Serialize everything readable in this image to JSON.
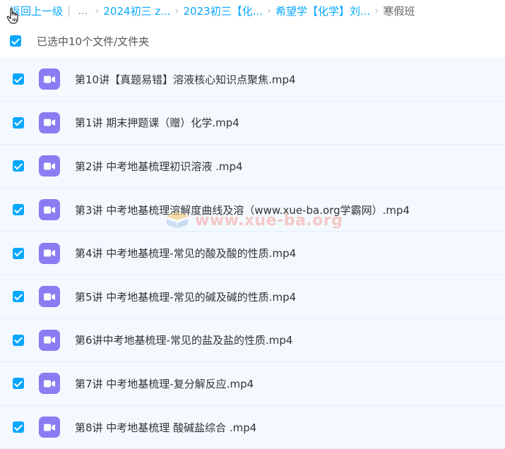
{
  "breadcrumb": {
    "back": "返回上一级",
    "divider": "|",
    "ellipsis": "...",
    "crumbs": [
      "2024初三 z...",
      "2023初三【化...",
      "希望学【化学】刘..."
    ],
    "current": "寒假班"
  },
  "selection": {
    "text": "已选中10个文件/文件夹"
  },
  "files": [
    {
      "name": "第10讲【真题易错】溶液核心知识点聚焦.mp4",
      "checked": true
    },
    {
      "name": "第1讲 期末押题课（赠）化学.mp4",
      "checked": true
    },
    {
      "name": "第2讲 中考地基梳理初识溶液 .mp4",
      "checked": true
    },
    {
      "name": "第3讲 中考地基梳理溶解度曲线及溶（www.xue-ba.org学霸网）.mp4",
      "checked": true
    },
    {
      "name": "第4讲 中考地基梳理-常见的酸及酸的性质.mp4",
      "checked": true
    },
    {
      "name": "第5讲 中考地基梳理-常见的碱及碱的性质.mp4",
      "checked": true
    },
    {
      "name": "第6讲中考地基梳理-常见的盐及盐的性质.mp4",
      "checked": true
    },
    {
      "name": "第7讲 中考地基梳理-复分解反应.mp4",
      "checked": true
    },
    {
      "name": "第8讲 中考地基梳理 酸碱盐综合 .mp4",
      "checked": true
    }
  ],
  "watermark": {
    "text": "www.xue-ba.org"
  },
  "colors": {
    "accent": "#06a7ff",
    "video_icon": "#8a7cf2",
    "row_bg": "#f4f9ff"
  }
}
